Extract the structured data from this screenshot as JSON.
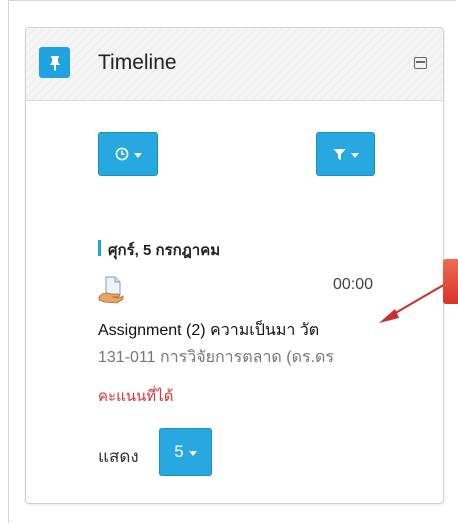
{
  "block": {
    "title": "Timeline",
    "pin_icon": "pin-icon",
    "collapse_icon": "collapse-icon"
  },
  "toolbar": {
    "sort_icon": "clock-icon",
    "filter_icon": "filter-icon"
  },
  "timeline": {
    "date_heading": "ศุกร์, 5 กรกฎาคม",
    "event": {
      "icon": "assignment-icon",
      "time": "00:00",
      "name": "Assignment (2) ความเป็นมา วัต",
      "course": "131-011 การวิจัยการตลาด (ดร.ดร",
      "action_label": "คะแนนที่ได้"
    }
  },
  "pagination": {
    "show_label": "แสดง",
    "page_size": "5"
  },
  "colors": {
    "accent": "#1fa2df",
    "button": "#27a8e0",
    "action_red": "#d9343a",
    "annotation": "#e8483a"
  }
}
